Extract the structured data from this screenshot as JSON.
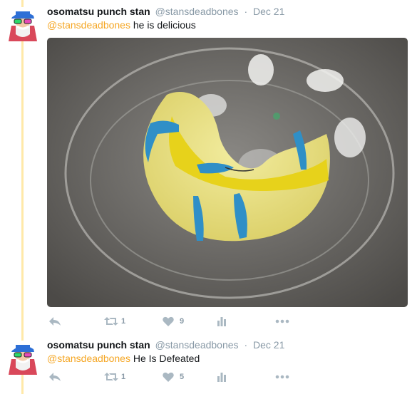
{
  "tweets": [
    {
      "display_name": "osomatsu punch stan",
      "handle": "@stansdeadbones",
      "dot": "·",
      "date": "Dec 21",
      "mention": "@stansdeadbones",
      "body": " he is delicious",
      "retweets": "1",
      "likes": "9"
    },
    {
      "display_name": "osomatsu punch stan",
      "handle": "@stansdeadbones",
      "dot": "·",
      "date": "Dec 21",
      "mention": "@stansdeadbones",
      "body": " He Is Defeated",
      "retweets": "1",
      "likes": "5"
    }
  ],
  "icons": {
    "reply": "reply-icon",
    "retweet": "retweet-icon",
    "like": "heart-icon",
    "analytics": "analytics-icon",
    "more": "more-icon"
  },
  "colors": {
    "mention": "#f5a623",
    "thread_line": "#ffe9a8",
    "muted": "#8899a6",
    "icon": "#aab8c2"
  }
}
